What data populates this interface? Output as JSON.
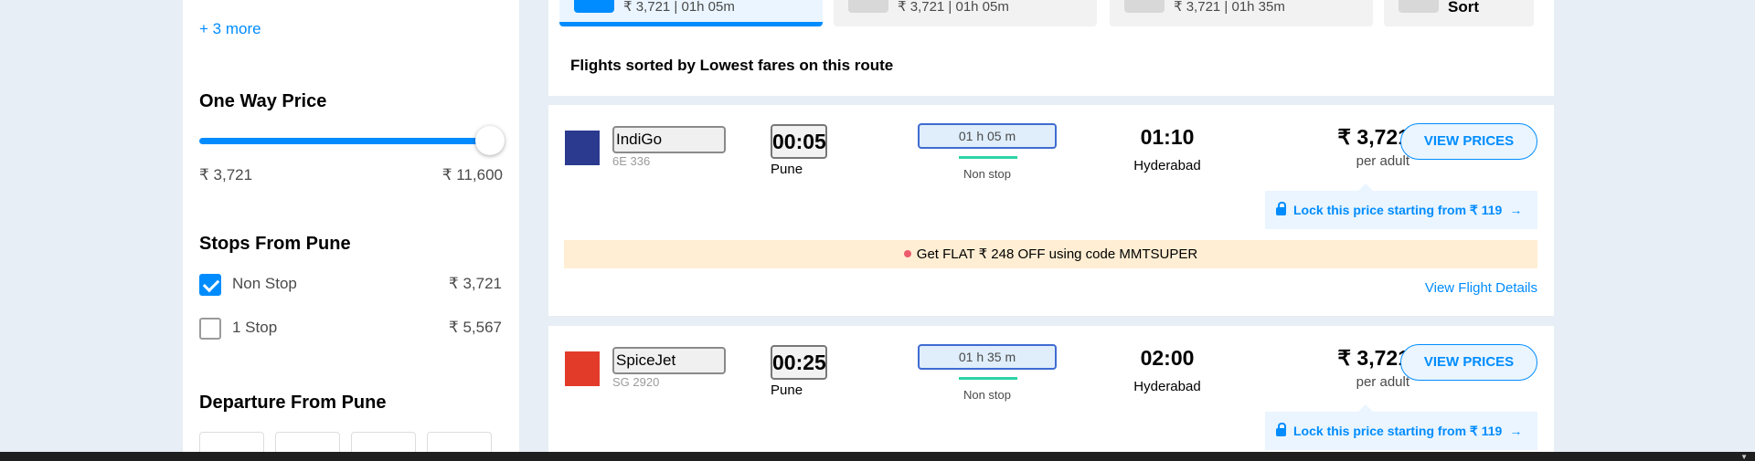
{
  "sidebar": {
    "more_link": "+ 3 more",
    "price_title": "One Way Price",
    "price_min": "₹ 3,721",
    "price_max": "₹ 11,600",
    "stops_title": "Stops From Pune",
    "stops": [
      {
        "label": "Non Stop",
        "price": "₹ 3,721",
        "checked": true
      },
      {
        "label": "1 Stop",
        "price": "₹ 5,567",
        "checked": false
      }
    ],
    "departure_title": "Departure From Pune"
  },
  "tabs": [
    {
      "text": "₹ 3,721 | 01h 05m",
      "active": true
    },
    {
      "text": "₹ 3,721 | 01h 05m",
      "active": false
    },
    {
      "text": "₹ 3,721 | 01h 35m",
      "active": false
    },
    {
      "text": "Sort",
      "active": false
    }
  ],
  "sort_heading": "Flights sorted by Lowest fares on this route",
  "flights": [
    {
      "airline": "IndiGo",
      "code": "6E 336",
      "dep_time": "00:05",
      "dep_city": "Pune",
      "duration": "01 h 05 m",
      "stops": "Non stop",
      "arr_time": "01:10",
      "arr_city": "Hyderabad",
      "price": "₹ 3,721",
      "per_adult": "per adult",
      "button": "VIEW PRICES",
      "lock": "Lock this price starting from ₹ 119",
      "offer": "Get FLAT ₹ 248 OFF using code MMTSUPER",
      "details": "View Flight Details"
    },
    {
      "airline": "SpiceJet",
      "code": "SG 2920",
      "dep_time": "00:25",
      "dep_city": "Pune",
      "duration": "01 h 35 m",
      "stops": "Non stop",
      "arr_time": "02:00",
      "arr_city": "Hyderabad",
      "price": "₹ 3,721",
      "per_adult": "per adult",
      "button": "VIEW PRICES",
      "lock": "Lock this price starting from ₹ 119"
    }
  ],
  "icons": {
    "lock": "lock-icon",
    "arrow": "→",
    "scroll": "▼"
  },
  "colors": {
    "accent": "#008cff",
    "offer_bg": "#ffeed3",
    "stop_line": "#2dd4a5"
  }
}
